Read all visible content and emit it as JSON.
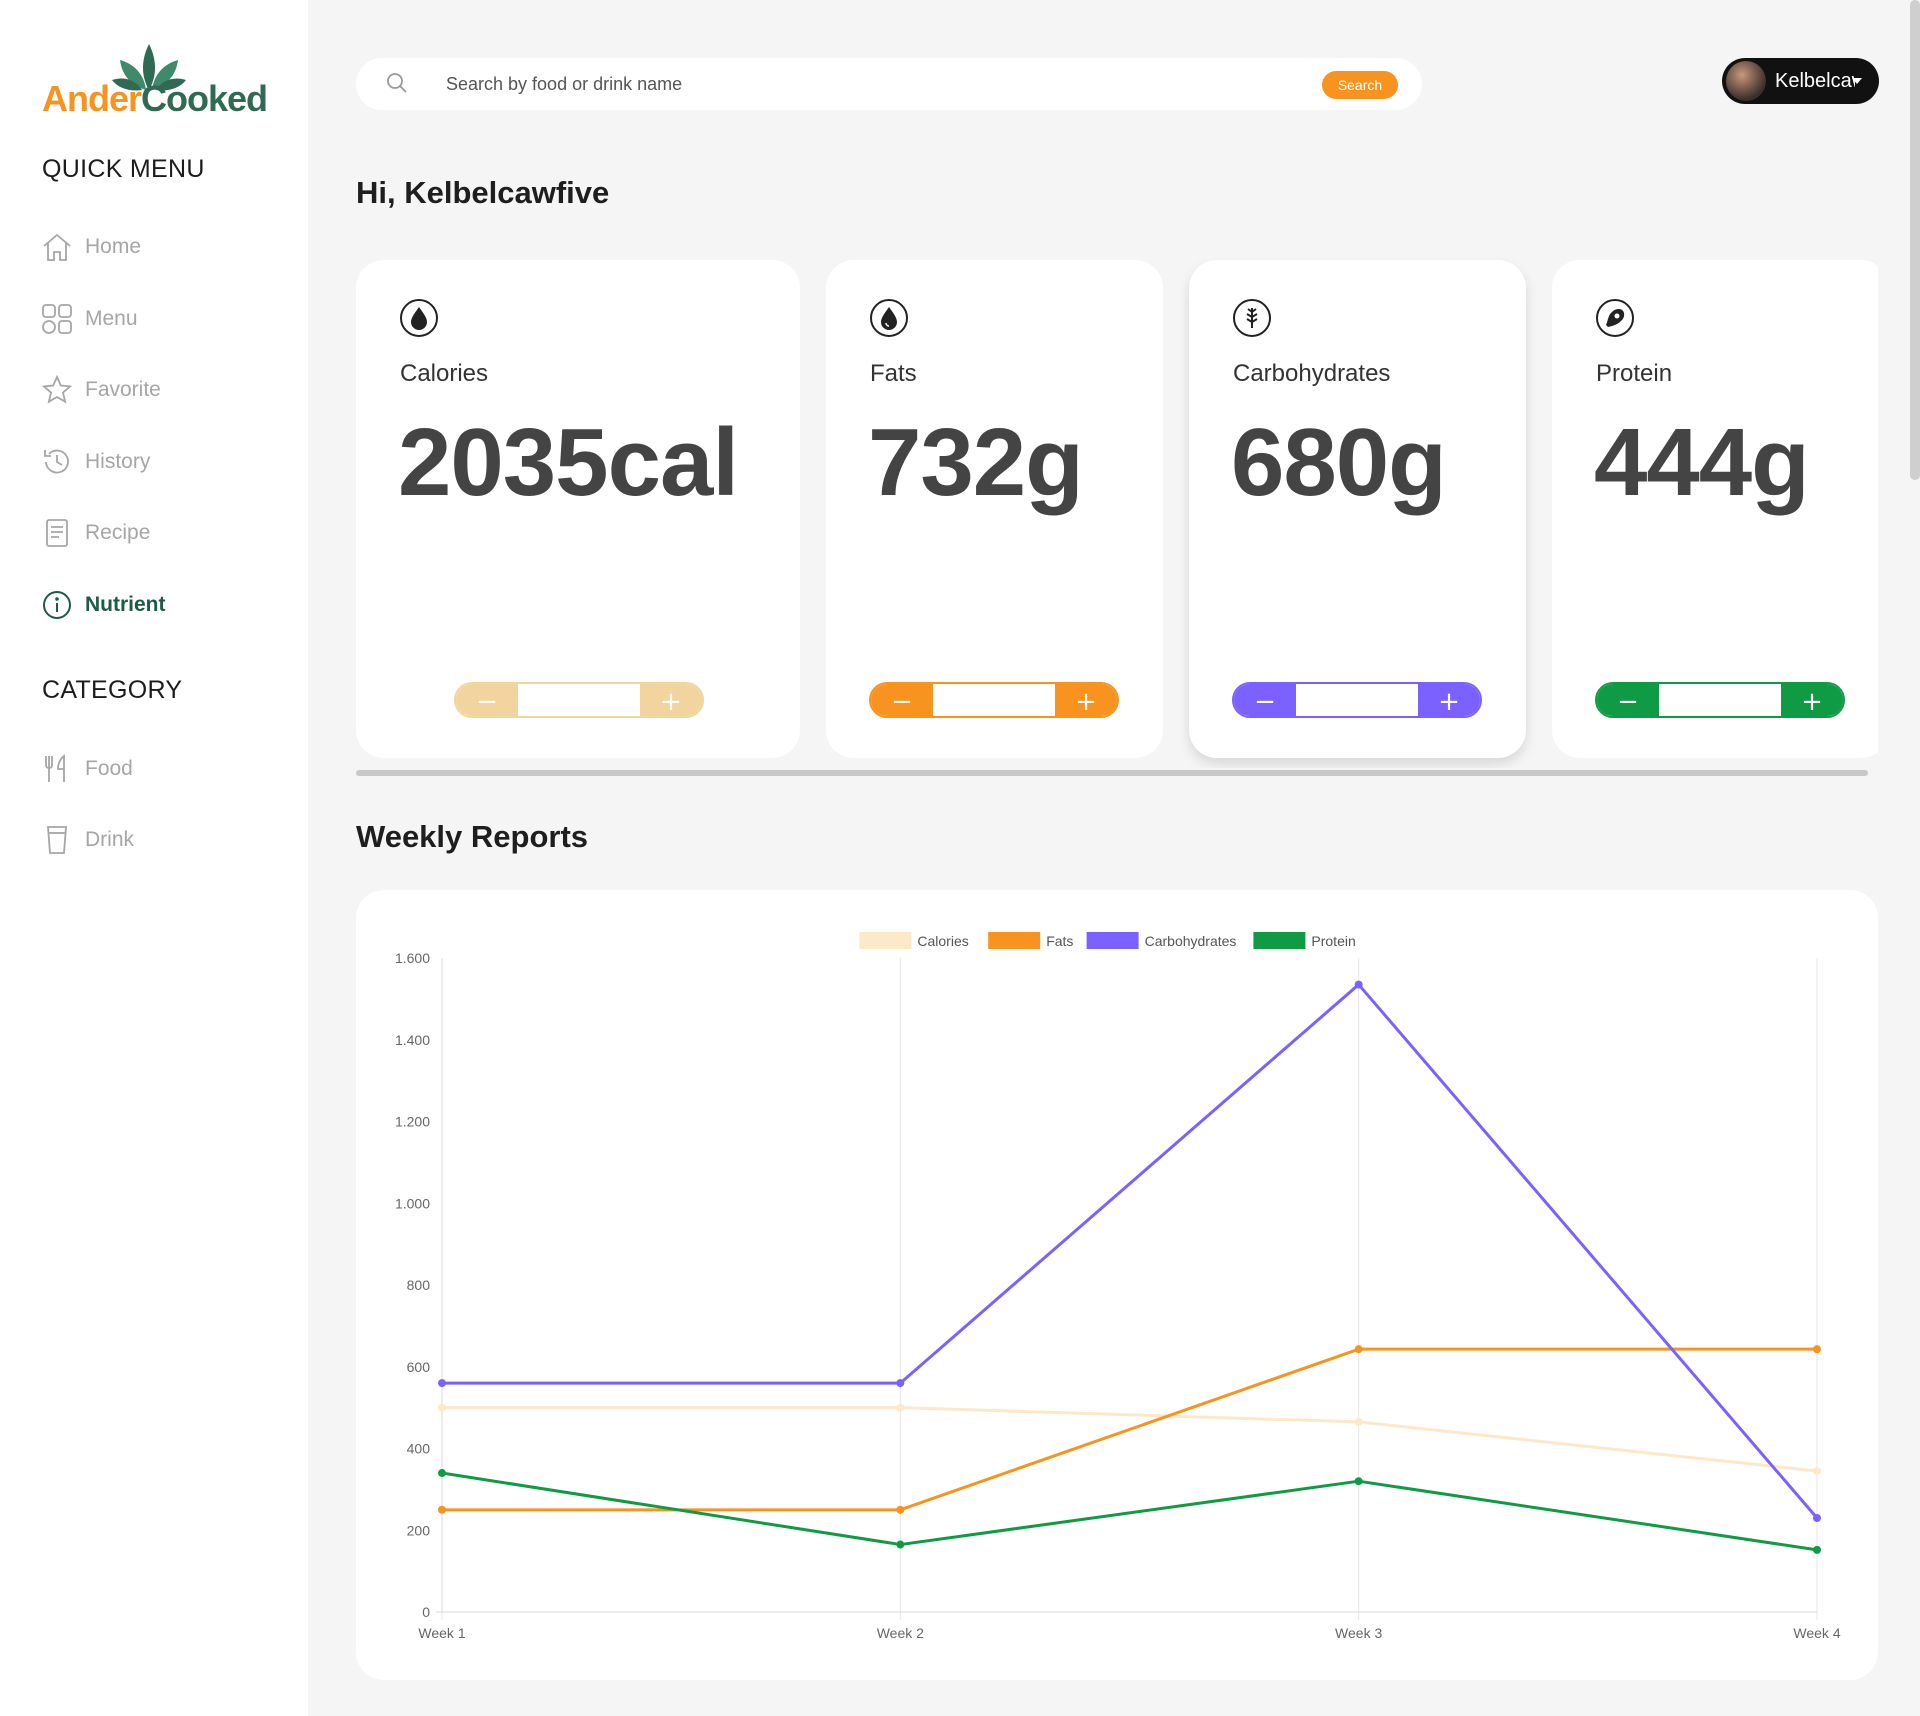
{
  "brand": {
    "part1": "Ander",
    "part2": "Cooked"
  },
  "quick_menu": {
    "title": "QUICK MENU",
    "items": [
      {
        "label": "Home",
        "icon": "home-icon"
      },
      {
        "label": "Menu",
        "icon": "grid-icon"
      },
      {
        "label": "Favorite",
        "icon": "star-icon"
      },
      {
        "label": "History",
        "icon": "history-icon"
      },
      {
        "label": "Recipe",
        "icon": "document-icon"
      },
      {
        "label": "Nutrient",
        "icon": "info-icon",
        "active": true
      }
    ]
  },
  "category": {
    "title": "CATEGORY",
    "items": [
      {
        "label": "Food",
        "icon": "fork-knife-icon"
      },
      {
        "label": "Drink",
        "icon": "cup-icon"
      }
    ]
  },
  "search": {
    "placeholder": "Search by food or drink name",
    "button_label": "Search"
  },
  "user": {
    "name": "Kelbelcawfive"
  },
  "greeting": "Hi, Kelbelcawfive",
  "cards": [
    {
      "title": "Calories",
      "value": "2035cal",
      "color": "#f2d59e",
      "icon": "drop-icon"
    },
    {
      "title": "Fats",
      "value": "732g",
      "color": "#f7931e",
      "icon": "drop-outline-icon"
    },
    {
      "title": "Carbohydrates",
      "value": "680g",
      "color": "#7b61ff",
      "icon": "wheat-icon"
    },
    {
      "title": "Protein",
      "value": "444g",
      "color": "#0f9b43",
      "icon": "meat-icon"
    }
  ],
  "stepper": {
    "minus": "−",
    "plus": "+"
  },
  "weekly_title": "Weekly Reports",
  "chart_data": {
    "type": "line",
    "categories": [
      "Week 1",
      "Week 2",
      "Week 3",
      "Week 4"
    ],
    "ylim": [
      0,
      1600
    ],
    "yticks": [
      0,
      200,
      400,
      600,
      800,
      1000,
      1200,
      1400,
      1600
    ],
    "ytick_labels": [
      "0",
      "200",
      "400",
      "600",
      "800",
      "1.000",
      "1.200",
      "1.400",
      "1.600"
    ],
    "grid": "vertical",
    "legend": "top-center",
    "series": [
      {
        "name": "Calories",
        "color": "#fde8c8",
        "values": [
          500,
          500,
          465,
          345
        ]
      },
      {
        "name": "Fats",
        "color": "#f7931e",
        "values": [
          250,
          250,
          643,
          643
        ]
      },
      {
        "name": "Carbohydrates",
        "color": "#7b61ff",
        "values": [
          560,
          560,
          1535,
          230
        ]
      },
      {
        "name": "Protein",
        "color": "#0f9b43",
        "values": [
          340,
          165,
          320,
          152
        ]
      }
    ]
  }
}
